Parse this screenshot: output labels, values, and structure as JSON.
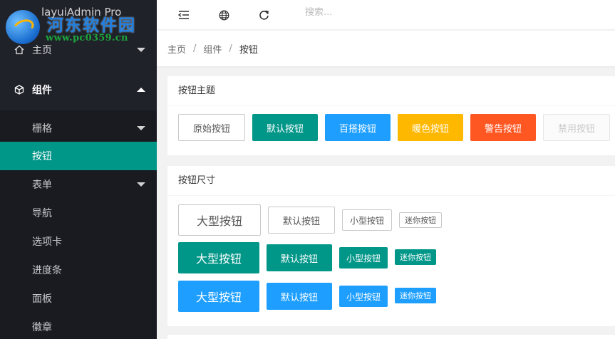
{
  "app": {
    "title": "layuiAdmin Pro"
  },
  "watermark": {
    "title": "河东软件园",
    "url": "www.pc0359.cn"
  },
  "sidebar": {
    "home": {
      "label": "主页",
      "icon": "home-icon"
    },
    "components": {
      "label": "组件",
      "icon": "cube-icon"
    },
    "sub_items": [
      {
        "label": "栅格",
        "has_arrow": true
      },
      {
        "label": "按钮",
        "active": true
      },
      {
        "label": "表单",
        "has_arrow": true
      },
      {
        "label": "导航"
      },
      {
        "label": "选项卡"
      },
      {
        "label": "进度条"
      },
      {
        "label": "面板"
      },
      {
        "label": "徽章"
      }
    ]
  },
  "header": {
    "icons": [
      "shrink-menu-icon",
      "globe-icon",
      "refresh-icon"
    ],
    "search_placeholder": "搜索..."
  },
  "breadcrumb": {
    "items": [
      "主页",
      "组件",
      "按钮"
    ],
    "separator": "/"
  },
  "theme_card": {
    "title": "按钮主题",
    "buttons": [
      "原始按钮",
      "默认按钮",
      "百搭按钮",
      "暖色按钮",
      "警告按钮",
      "禁用按钮"
    ]
  },
  "size_card": {
    "title": "按钮尺寸",
    "rows": [
      [
        "大型按钮",
        "默认按钮",
        "小型按钮",
        "迷你按钮"
      ],
      [
        "大型按钮",
        "默认按钮",
        "小型按钮",
        "迷你按钮"
      ],
      [
        "大型按钮",
        "默认按钮",
        "小型按钮",
        "迷你按钮"
      ]
    ]
  },
  "colors": {
    "sidebar_bg": "#20222a",
    "active": "#009688",
    "normal": "#1e9fff",
    "warm": "#ffb800",
    "danger": "#ff5722"
  }
}
